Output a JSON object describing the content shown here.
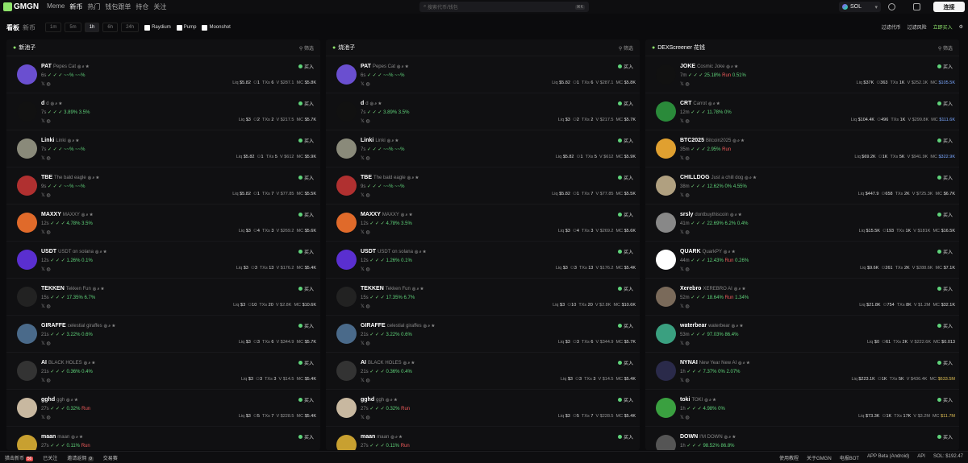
{
  "topbar": {
    "logo": "GMGN",
    "nav": [
      "Meme",
      "新币",
      "热门",
      "钱包跟单",
      "持仓",
      "关注"
    ],
    "search_placeholder": "搜索代币/钱包",
    "search_kbd": "⌘K",
    "chain": "SOL",
    "connect": "连接"
  },
  "subbar": {
    "tab": "看板",
    "tab2": "新币",
    "timeframes": [
      "1m",
      "5m",
      "1h",
      "6h",
      "24h"
    ],
    "active_tf": "1h",
    "checks": [
      "Raydium",
      "Pump",
      "Moonshot"
    ],
    "tools": [
      "过滤代币",
      "过滤风险",
      "立即买入"
    ]
  },
  "columns": [
    {
      "title": "新池子",
      "filter": "筛选",
      "cards": [
        {
          "name": "PAT",
          "sub": "Pepes Cat",
          "age": "6s",
          "l2": "~~%",
          "l2b": "~~%",
          "liq": "$5.82",
          "holders": "1",
          "txs": "6",
          "vol": "$287.1",
          "mc": "$5.8K",
          "color": "#6a4fd0"
        },
        {
          "name": "d",
          "sub": "d",
          "age": "7s",
          "l2": "3.89%",
          "l2b": "3.5%",
          "liq": "$3",
          "holders": "2",
          "txs": "2",
          "vol": "$217.5",
          "mc": "$5.7K",
          "color": "#111"
        },
        {
          "name": "Linki",
          "sub": "Linki",
          "age": "7s",
          "l2": "~~%",
          "l2b": "~~%",
          "liq": "$5.82",
          "holders": "1",
          "txs": "5",
          "vol": "$612",
          "mc": "$5.9K",
          "color": "#8a8a7a"
        },
        {
          "name": "TBE",
          "sub": "The bald eagle",
          "age": "9s",
          "l2": "~~%",
          "l2b": "~~%",
          "liq": "$5.82",
          "holders": "1",
          "txs": "7",
          "vol": "$77.85",
          "mc": "$5.5K",
          "color": "#b03030"
        },
        {
          "name": "MAXXY",
          "sub": "MAXXY",
          "age": "12s",
          "l2": "4.78%",
          "l2b": "3.5%",
          "liq": "$3",
          "holders": "4",
          "txs": "3",
          "vol": "$269.2",
          "mc": "$5.6K",
          "color": "#e06a2a"
        },
        {
          "name": "USDT",
          "sub": "USDT on solana",
          "age": "12s",
          "l2": "1.26%",
          "l2b": "0.1%",
          "liq": "$3",
          "holders": "3",
          "txs": "13",
          "vol": "$176.2",
          "mc": "$5.4K",
          "color": "#5a2fd0"
        },
        {
          "name": "TEKKEN",
          "sub": "Tekken Fun",
          "age": "15s",
          "l2": "17.35%",
          "l2b": "6.7%",
          "liq": "$3",
          "holders": "10",
          "txs": "20",
          "vol": "$2.8K",
          "mc": "$10.6K",
          "color": "#222"
        },
        {
          "name": "GIRAFFE",
          "sub": "celestial giraffes",
          "age": "21s",
          "l2": "3.22%",
          "l2b": "0.6%",
          "liq": "$3",
          "holders": "3",
          "txs": "6",
          "vol": "$344.9",
          "mc": "$5.7K",
          "color": "#4a6a8a"
        },
        {
          "name": "AI",
          "sub": "BLACK HOLES",
          "age": "21s",
          "l2": "0.36%",
          "l2b": "0.4%",
          "liq": "$3",
          "holders": "3",
          "txs": "3",
          "vol": "$14.5",
          "mc": "$5.4K",
          "color": "#333"
        },
        {
          "name": "gghd",
          "sub": "ggh",
          "age": "27s",
          "l2": "0.32%",
          "l2b": "Run",
          "liq": "$3",
          "holders": "5",
          "txs": "7",
          "vol": "$228.5",
          "mc": "$5.4K",
          "color": "#c8b8a0"
        },
        {
          "name": "maan",
          "sub": "maan",
          "age": "27s",
          "l2": "0.11%",
          "l2b": "Run",
          "liq": "",
          "holders": "",
          "txs": "",
          "vol": "",
          "mc": "",
          "color": "#c8a030"
        }
      ]
    },
    {
      "title": "烧池子",
      "filter": "筛选",
      "cards": [
        {
          "name": "PAT",
          "sub": "Pepes Cat",
          "age": "6s",
          "l2": "~~%",
          "l2b": "~~%",
          "liq": "$5.82",
          "holders": "1",
          "txs": "6",
          "vol": "$287.1",
          "mc": "$5.8K",
          "color": "#6a4fd0"
        },
        {
          "name": "d",
          "sub": "d",
          "age": "7s",
          "l2": "3.89%",
          "l2b": "3.5%",
          "liq": "$3",
          "holders": "2",
          "txs": "2",
          "vol": "$217.5",
          "mc": "$5.7K",
          "color": "#111"
        },
        {
          "name": "Linki",
          "sub": "Linki",
          "age": "7s",
          "l2": "~~%",
          "l2b": "~~%",
          "liq": "$5.82",
          "holders": "1",
          "txs": "5",
          "vol": "$612",
          "mc": "$5.9K",
          "color": "#8a8a7a"
        },
        {
          "name": "TBE",
          "sub": "The bald eagle",
          "age": "9s",
          "l2": "~~%",
          "l2b": "~~%",
          "liq": "$5.82",
          "holders": "1",
          "txs": "7",
          "vol": "$77.85",
          "mc": "$5.5K",
          "color": "#b03030"
        },
        {
          "name": "MAXXY",
          "sub": "MAXXY",
          "age": "12s",
          "l2": "4.78%",
          "l2b": "3.5%",
          "liq": "$3",
          "holders": "4",
          "txs": "3",
          "vol": "$269.2",
          "mc": "$5.6K",
          "color": "#e06a2a"
        },
        {
          "name": "USDT",
          "sub": "USDT on solana",
          "age": "12s",
          "l2": "1.26%",
          "l2b": "0.1%",
          "liq": "$3",
          "holders": "3",
          "txs": "13",
          "vol": "$176.2",
          "mc": "$5.4K",
          "color": "#5a2fd0"
        },
        {
          "name": "TEKKEN",
          "sub": "Tekken Fun",
          "age": "15s",
          "l2": "17.35%",
          "l2b": "6.7%",
          "liq": "$3",
          "holders": "10",
          "txs": "20",
          "vol": "$2.8K",
          "mc": "$10.6K",
          "color": "#222"
        },
        {
          "name": "GIRAFFE",
          "sub": "celestial giraffes",
          "age": "21s",
          "l2": "3.22%",
          "l2b": "0.6%",
          "liq": "$3",
          "holders": "3",
          "txs": "6",
          "vol": "$344.9",
          "mc": "$5.7K",
          "color": "#4a6a8a"
        },
        {
          "name": "AI",
          "sub": "BLACK HOLES",
          "age": "21s",
          "l2": "0.36%",
          "l2b": "0.4%",
          "liq": "$3",
          "holders": "3",
          "txs": "3",
          "vol": "$14.5",
          "mc": "$5.4K",
          "color": "#333"
        },
        {
          "name": "gghd",
          "sub": "ggh",
          "age": "27s",
          "l2": "0.32%",
          "l2b": "Run",
          "liq": "$3",
          "holders": "5",
          "txs": "7",
          "vol": "$228.5",
          "mc": "$5.4K",
          "color": "#c8b8a0"
        },
        {
          "name": "maan",
          "sub": "maan",
          "age": "27s",
          "l2": "0.11%",
          "l2b": "Run",
          "liq": "",
          "holders": "",
          "txs": "",
          "vol": "",
          "mc": "",
          "color": "#c8a030"
        }
      ]
    },
    {
      "title": "DEXScreener 花钱",
      "filter": "筛选",
      "cards": [
        {
          "name": "JOKE",
          "sub": "Cosmic Joke",
          "age": "7m",
          "l2": "25.18%",
          "l2b": "Run",
          "l2c": "0.51%",
          "liq": "$37K",
          "holders": "363",
          "txs": "1K",
          "vol": "$252.1K",
          "mc": "$105.5K",
          "color": "#111",
          "mcc": "hl"
        },
        {
          "name": "CRT",
          "sub": "Carrot",
          "age": "12m",
          "l2": "11.78%",
          "l2b": "0%",
          "liq": "$104.4K",
          "holders": "496",
          "txs": "1K",
          "vol": "$299.8K",
          "mc": "$111.6K",
          "color": "#2a8a3a",
          "mcc": "hl"
        },
        {
          "name": "BTC2025",
          "sub": "Bitcoin2025",
          "age": "35m",
          "l2": "2.95%",
          "l2b": "Run",
          "liq": "$69.2K",
          "holders": "1K",
          "txs": "5K",
          "vol": "$941.9K",
          "mc": "$322.9K",
          "color": "#e0a030",
          "mcc": "hl"
        },
        {
          "name": "CHILLDOG",
          "sub": "Just a chill dog",
          "age": "38m",
          "l2": "12.62%",
          "l2b": "0%",
          "l2c": "4.55%",
          "liq": "$447.9",
          "holders": "658",
          "txs": "2K",
          "vol": "$725.3K",
          "mc": "$6.7K",
          "color": "#b0a080",
          "mcc": ""
        },
        {
          "name": "srsly",
          "sub": "dontbuythiscoin",
          "age": "41m",
          "l2": "22.69%",
          "l2b": "6.2%",
          "l2c": "0.4%",
          "liq": "$15.5K",
          "holders": "193",
          "txs": "1K",
          "vol": "$181K",
          "mc": "$16.5K",
          "color": "#888",
          "mcc": ""
        },
        {
          "name": "QUARK",
          "sub": "QuarkPY",
          "age": "44m",
          "l2": "12.43%",
          "l2b": "Run",
          "l2c": "0.26%",
          "liq": "$9.6K",
          "holders": "261",
          "txs": "2K",
          "vol": "$288.6K",
          "mc": "$7.1K",
          "color": "#fff",
          "mcc": ""
        },
        {
          "name": "Xerebro",
          "sub": "XEREBRO AI",
          "age": "52m",
          "l2": "18.64%",
          "l2b": "Run",
          "l2c": "1.34%",
          "liq": "$21.8K",
          "holders": "754",
          "txs": "8K",
          "vol": "$1.2M",
          "mc": "$32.1K",
          "color": "#7a6a5a",
          "mcc": ""
        },
        {
          "name": "waterbear",
          "sub": "waterbear",
          "age": "53m",
          "l2": "97.03%",
          "l2b": "86.4%",
          "liq": "$0",
          "holders": "61",
          "txs": "2K",
          "vol": "$222.6K",
          "mc": "$0.013",
          "color": "#3aa080",
          "mcc": ""
        },
        {
          "name": "NYNAI",
          "sub": "New Year New AI",
          "age": "1h",
          "l2": "7.37%",
          "l2b": "0%",
          "l2c": "2.07%",
          "liq": "$223.1K",
          "holders": "1K",
          "txs": "5K",
          "vol": "$436.4K",
          "mc": "$633.5M",
          "color": "#2a2a4a",
          "mcc": "y"
        },
        {
          "name": "toki",
          "sub": "TOKI",
          "age": "1h",
          "l2": "4.98%",
          "l2b": "0%",
          "liq": "$73.3K",
          "holders": "1K",
          "txs": "17K",
          "vol": "$3.2M",
          "mc": "$11.7M",
          "color": "#3aa040",
          "mcc": "y"
        },
        {
          "name": "DOWN",
          "sub": "I'M DOWN",
          "age": "1h",
          "l2": "98.52%",
          "l2b": "86.8%",
          "liq": "",
          "holders": "",
          "txs": "",
          "vol": "",
          "mc": "",
          "color": "#555",
          "mcc": ""
        }
      ]
    }
  ],
  "buy_label": "买入",
  "stat_labels": {
    "liq": "Liq",
    "txs": "TXs",
    "vol": "V",
    "mc": "MC"
  },
  "footer": {
    "items": [
      "猎击新币",
      "已关注",
      "邀请返佣",
      "交易赛"
    ],
    "badge": "56",
    "badge2": "0",
    "right": [
      "使用教程",
      "关于GMGN",
      "电报BOT",
      "APP Beta (Android)",
      "API",
      "SOL: $192.47"
    ]
  }
}
